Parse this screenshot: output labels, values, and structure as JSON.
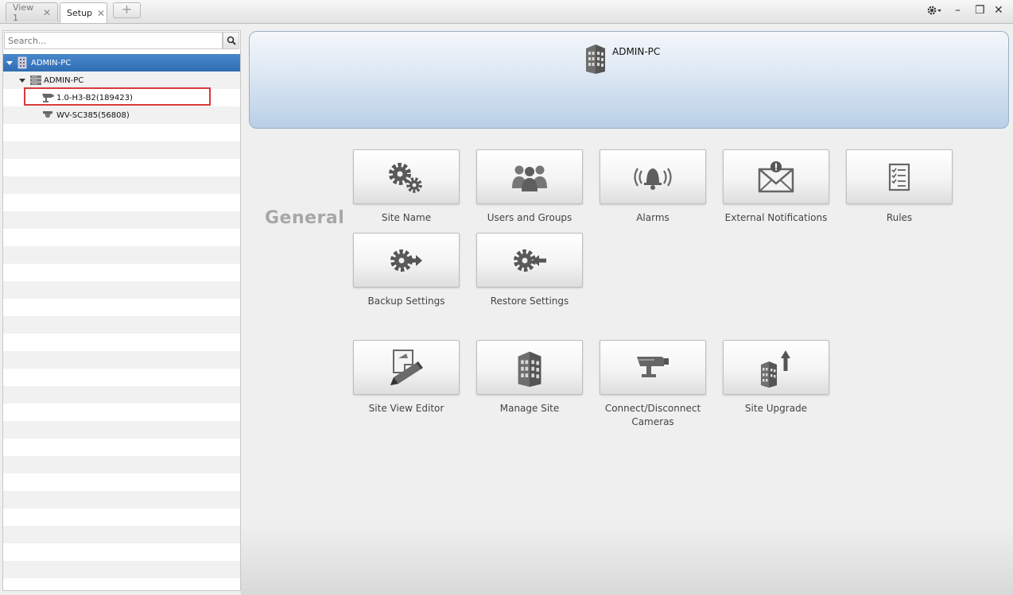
{
  "tabs": [
    {
      "label": "View 1",
      "active": false
    },
    {
      "label": "Setup",
      "active": true
    }
  ],
  "window_controls": {
    "settings_icon": "gear-icon",
    "minimize": "–",
    "restore": "❐",
    "close": "✕"
  },
  "search": {
    "placeholder": "Search..."
  },
  "tree": [
    {
      "label": "ADMIN-PC",
      "icon": "building-icon",
      "level": 0,
      "expanded": true,
      "selected": true
    },
    {
      "label": "ADMIN-PC",
      "icon": "server-icon",
      "level": 1,
      "expanded": true,
      "selected": false
    },
    {
      "label": "1.0-H3-B2(189423)",
      "icon": "camera-icon",
      "level": 2,
      "selected": false,
      "highlighted": true
    },
    {
      "label": "WV-SC385(56808)",
      "icon": "dome-camera-icon",
      "level": 2,
      "selected": false
    }
  ],
  "banner": {
    "title": "ADMIN-PC",
    "icon": "building-icon"
  },
  "section": {
    "label": "General"
  },
  "tiles": [
    {
      "label": "Site Name",
      "icon": "gears-icon"
    },
    {
      "label": "Users and Groups",
      "icon": "users-icon"
    },
    {
      "label": "Alarms",
      "icon": "alarm-bell-icon"
    },
    {
      "label": "External Notifications",
      "icon": "envelope-alert-icon"
    },
    {
      "label": "Rules",
      "icon": "checklist-icon"
    },
    {
      "label": "Backup Settings",
      "icon": "gear-arrow-out-icon"
    },
    {
      "label": "Restore Settings",
      "icon": "gear-arrow-in-icon"
    },
    {
      "label": "Site View Editor",
      "icon": "edit-pencil-icon"
    },
    {
      "label": "Manage Site",
      "icon": "building-icon"
    },
    {
      "label": "Connect/Disconnect Cameras",
      "icon": "camera-icon"
    },
    {
      "label": "Site Upgrade",
      "icon": "building-upgrade-icon"
    }
  ],
  "colors": {
    "selection": "#2f6db3",
    "highlight_box": "#d83a3a",
    "section_label": "#a7a7a7",
    "banner": "#b9cfe6"
  }
}
